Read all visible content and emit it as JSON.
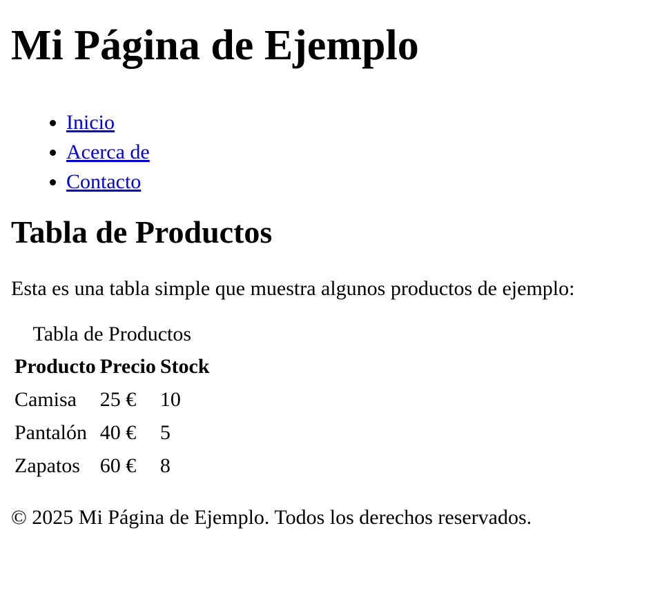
{
  "header": {
    "title": "Mi Página de Ejemplo"
  },
  "nav": {
    "items": [
      {
        "label": "Inicio"
      },
      {
        "label": "Acerca de"
      },
      {
        "label": "Contacto"
      }
    ]
  },
  "main": {
    "section_title": "Tabla de Productos",
    "intro": "Esta es una tabla simple que muestra algunos productos de ejemplo:",
    "table": {
      "caption": "Tabla de Productos",
      "headers": [
        "Producto",
        "Precio",
        "Stock"
      ],
      "rows": [
        [
          "Camisa",
          "25 €",
          "10"
        ],
        [
          "Pantalón",
          "40 €",
          "5"
        ],
        [
          "Zapatos",
          "60 €",
          "8"
        ]
      ]
    }
  },
  "footer": {
    "text": "© 2025 Mi Página de Ejemplo. Todos los derechos reservados."
  },
  "colors": {
    "link": "#0000ee",
    "text": "#000000",
    "background": "#ffffff"
  }
}
